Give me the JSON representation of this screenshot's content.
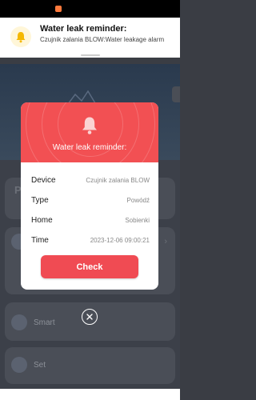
{
  "banner": {
    "title": "Water leak reminder:",
    "body": "Czujnik zalania BLOW:Water leakage alarm",
    "icon": "bell-icon"
  },
  "background": {
    "card_initial": "P",
    "items": [
      {
        "label": "Smart",
        "icon": "smart-icon"
      },
      {
        "label": "Set",
        "icon": "settings-icon"
      }
    ]
  },
  "modal": {
    "title": "Water leak reminder:",
    "rows": [
      {
        "key": "Device",
        "value": "Czujnik zalania BLOW"
      },
      {
        "key": "Type",
        "value": "Powódź"
      },
      {
        "key": "Home",
        "value": "Sobienki"
      },
      {
        "key": "Time",
        "value": "2023-12-06 09:00:21"
      }
    ],
    "button": "Check"
  },
  "colors": {
    "accent": "#f25053",
    "banner_bell": "#f5b800"
  }
}
